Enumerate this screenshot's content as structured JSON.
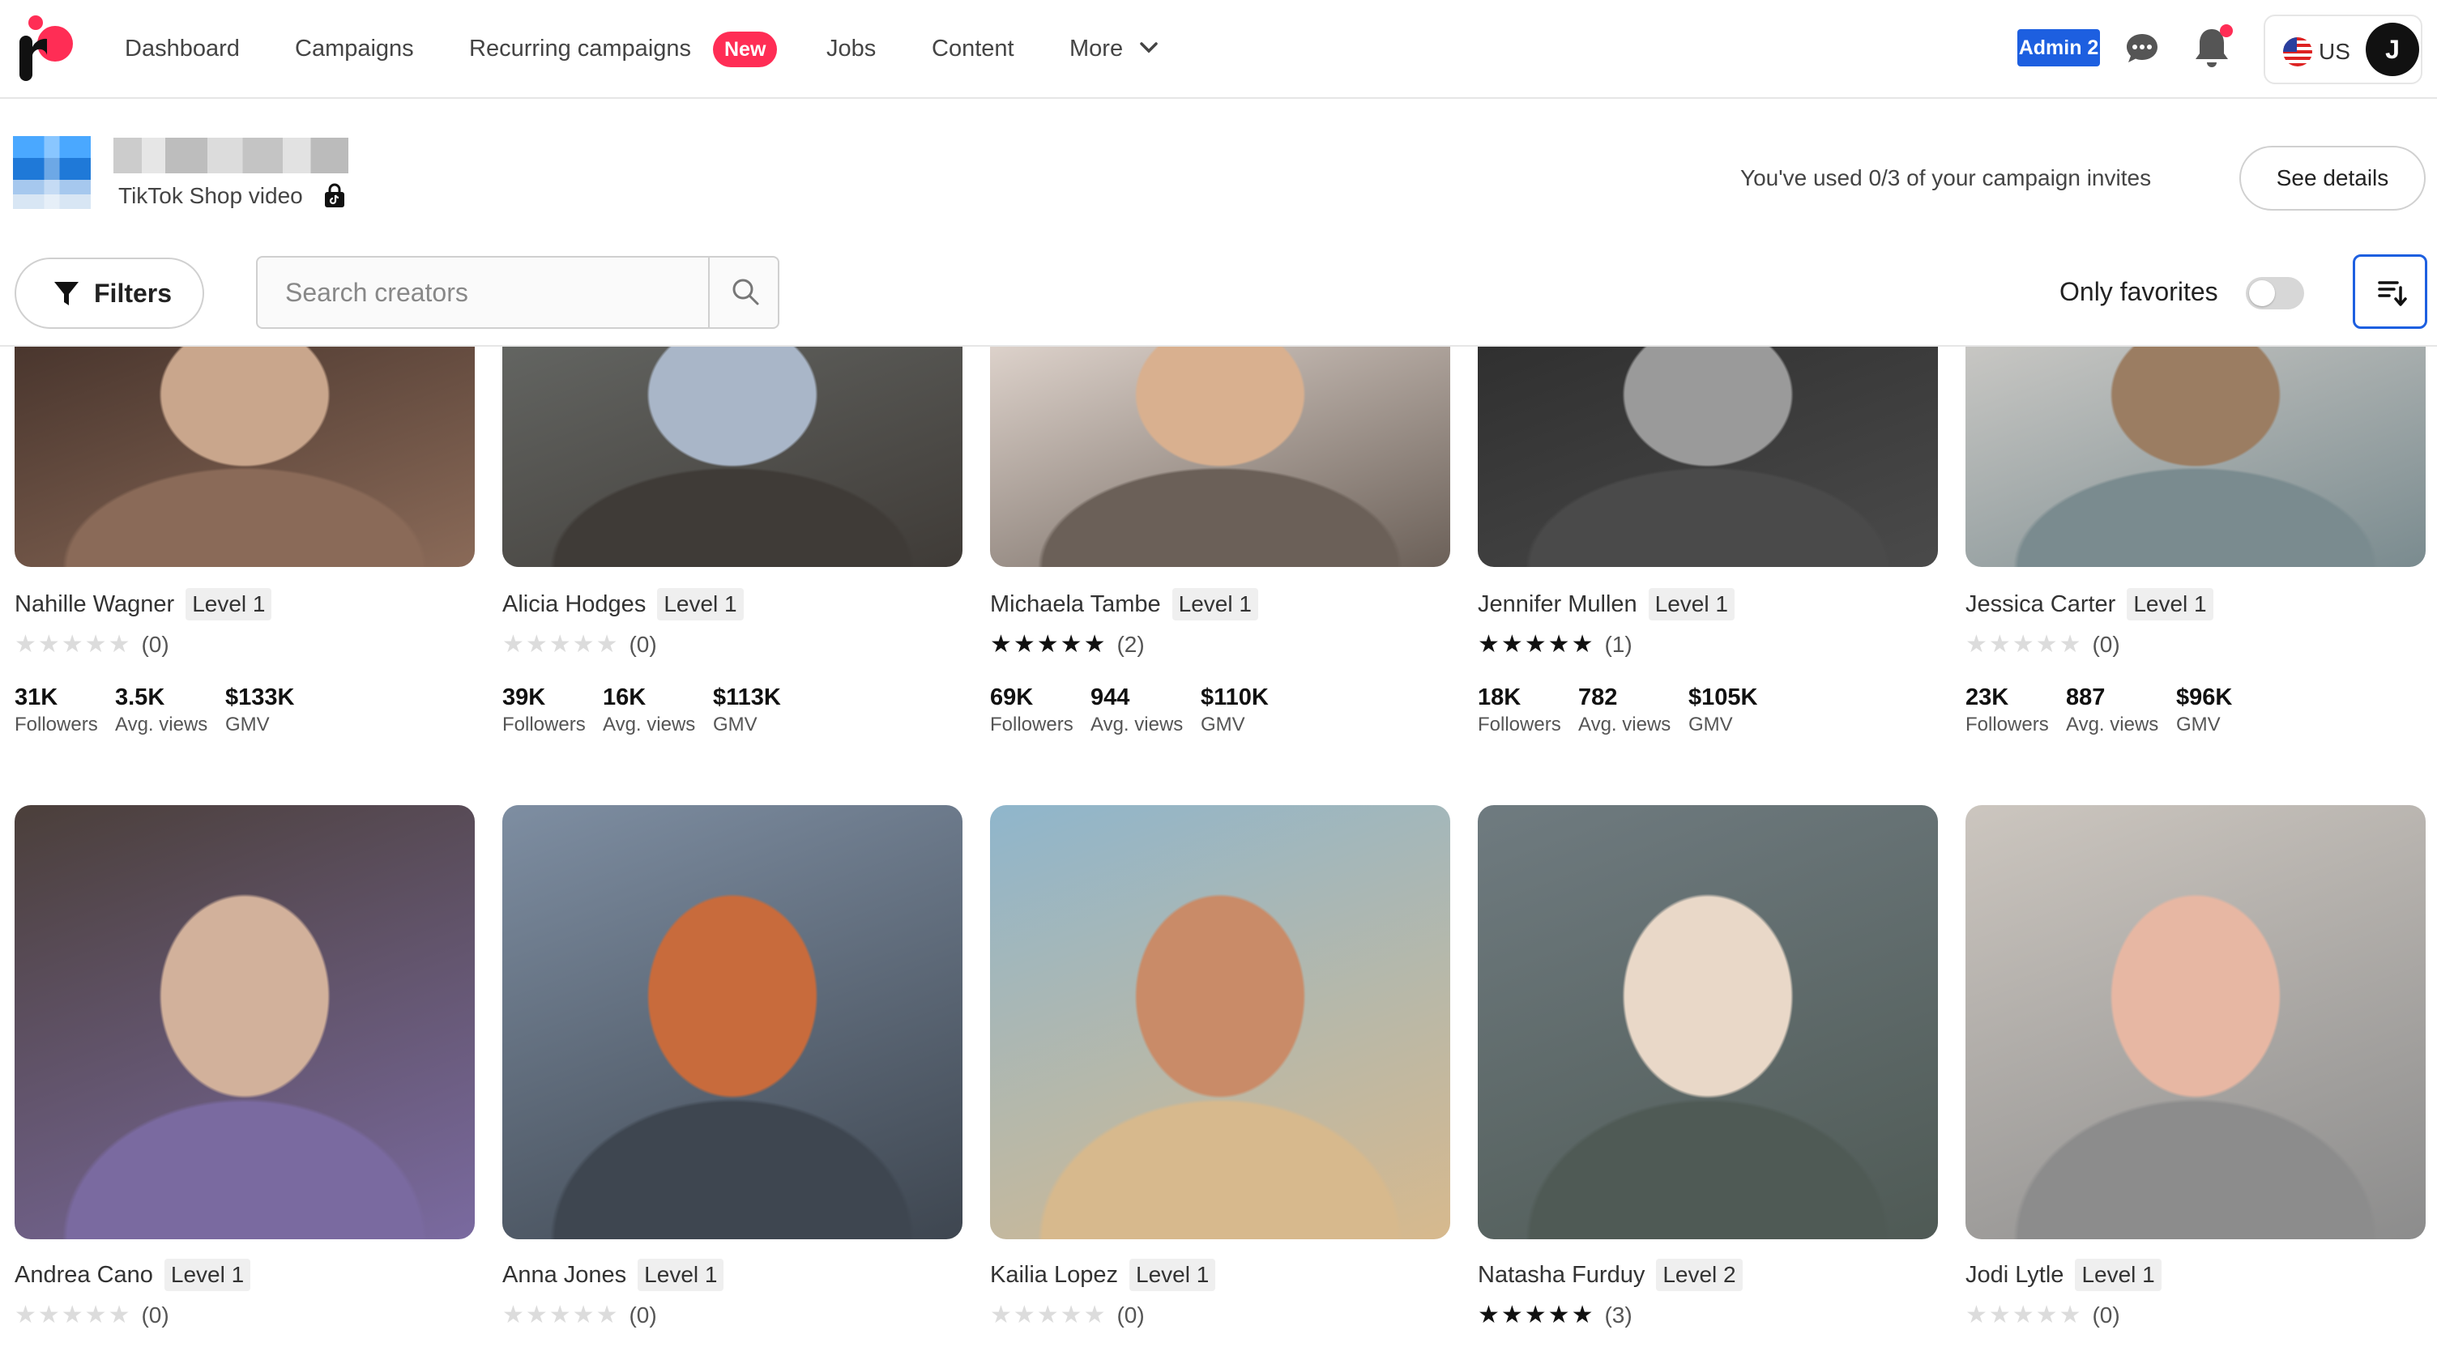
{
  "nav": {
    "items": [
      "Dashboard",
      "Campaigns",
      "Recurring campaigns",
      "Jobs",
      "Content",
      "More"
    ],
    "new_badge": "New",
    "admin_badge": "Admin 2",
    "region": "US",
    "avatar_initial": "J"
  },
  "campaign": {
    "type": "TikTok Shop video",
    "invites_text": "You've used 0/3 of your campaign invites",
    "details_button": "See details"
  },
  "toolbar": {
    "filters_label": "Filters",
    "search_placeholder": "Search creators",
    "favorites_label": "Only favorites",
    "favorites_on": false
  },
  "stat_labels": [
    "Followers",
    "Avg. views",
    "GMV"
  ],
  "creators": [
    {
      "name": "Nahille Wagner",
      "level": "Level 1",
      "rating": 0,
      "reviews": "(0)",
      "followers": "31K",
      "views": "3.5K",
      "gmv": "$133K"
    },
    {
      "name": "Alicia Hodges",
      "level": "Level 1",
      "rating": 0,
      "reviews": "(0)",
      "followers": "39K",
      "views": "16K",
      "gmv": "$113K"
    },
    {
      "name": "Michaela Tambe",
      "level": "Level 1",
      "rating": 5,
      "reviews": "(2)",
      "followers": "69K",
      "views": "944",
      "gmv": "$110K"
    },
    {
      "name": "Jennifer Mullen",
      "level": "Level 1",
      "rating": 5,
      "reviews": "(1)",
      "followers": "18K",
      "views": "782",
      "gmv": "$105K"
    },
    {
      "name": "Jessica Carter",
      "level": "Level 1",
      "rating": 0,
      "reviews": "(0)",
      "followers": "23K",
      "views": "887",
      "gmv": "$96K"
    },
    {
      "name": "Andrea Cano",
      "level": "Level 1",
      "rating": 0,
      "reviews": "(0)"
    },
    {
      "name": "Anna Jones",
      "level": "Level 1",
      "rating": 0,
      "reviews": "(0)"
    },
    {
      "name": "Kailia Lopez",
      "level": "Level 1",
      "rating": 0,
      "reviews": "(0)"
    },
    {
      "name": "Natasha Furduy",
      "level": "Level 2",
      "rating": 5,
      "reviews": "(3)"
    },
    {
      "name": "Jodi Lytle",
      "level": "Level 1",
      "rating": 0,
      "reviews": "(0)"
    }
  ],
  "icons": {
    "logo": "brand-logo",
    "chat": "chat-bubble-icon",
    "bell": "bell-icon",
    "flag": "us-flag-icon",
    "lock": "tiktok-shop-icon",
    "filter": "funnel-icon",
    "search": "search-icon",
    "sort": "sort-icon",
    "star": "star-icon"
  },
  "colors": {
    "accent": "#ff2d55",
    "admin": "#1d5fe0",
    "star_full": "#111111",
    "star_empty": "#dcdcdc"
  }
}
